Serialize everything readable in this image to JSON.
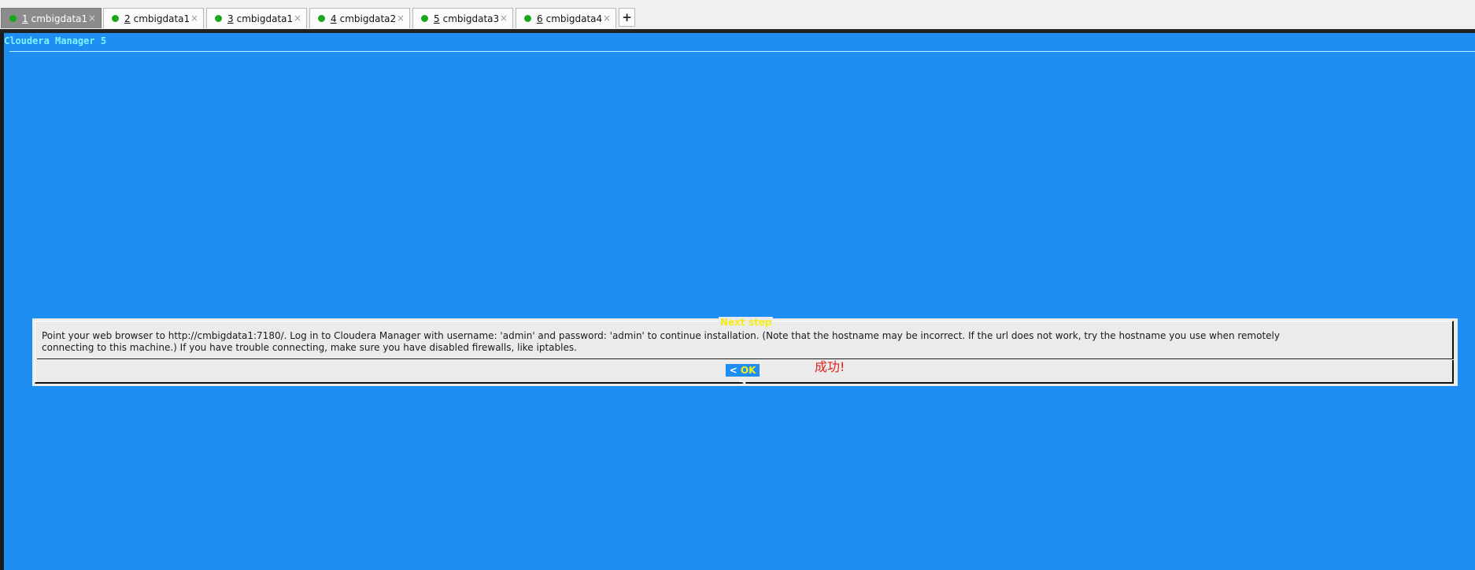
{
  "tabs": [
    {
      "num": "1",
      "label": "cmbigdata1",
      "close": "×",
      "active": true
    },
    {
      "num": "2",
      "label": "cmbigdata1",
      "close": "×",
      "active": false
    },
    {
      "num": "3",
      "label": "cmbigdata1",
      "close": "×",
      "active": false
    },
    {
      "num": "4",
      "label": "cmbigdata2",
      "close": "×",
      "active": false
    },
    {
      "num": "5",
      "label": "cmbigdata3",
      "close": "×",
      "active": false
    },
    {
      "num": "6",
      "label": "cmbigdata4",
      "close": "×",
      "active": false
    }
  ],
  "new_tab": "+",
  "terminal": {
    "backtitle": "Cloudera Manager 5",
    "dialog": {
      "title": "Next step",
      "line1": "Point your web browser to http://cmbigdata1:7180/. Log in to Cloudera Manager with username: 'admin' and password: 'admin' to continue installation. (Note that the hostname may be incorrect. If the url does not work, try the hostname you use when remotely",
      "line2": "connecting to this machine.) If you have trouble connecting, make sure you have disabled firewalls, like iptables.",
      "ok_left": "<",
      "ok_label": "OK",
      "ok_right": ">"
    }
  },
  "annotation": "成功!",
  "colors": {
    "terminal_bg": "#1e8ef2",
    "dialog_bg": "#ebebeb",
    "dialog_title": "#f3ee12",
    "backtitle": "#7ff3ff",
    "tab_dot": "#1aa81a",
    "annotation": "#e02020"
  }
}
